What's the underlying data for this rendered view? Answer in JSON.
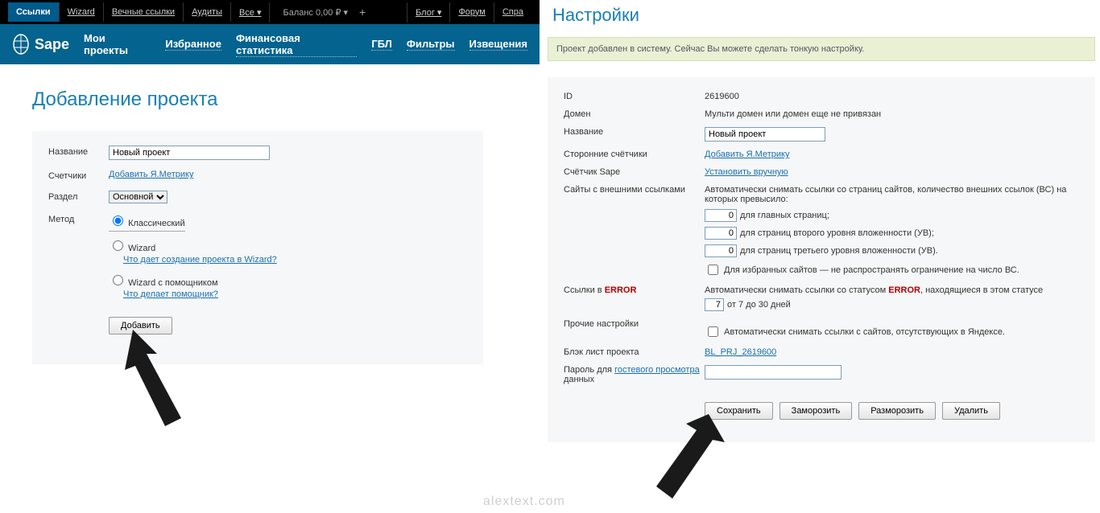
{
  "topbar": {
    "tabs": [
      "Ссылки",
      "Wizard",
      "Вечные ссылки",
      "Аудиты",
      "Все ▾"
    ],
    "balance": "Баланс 0,00 ₽ ▾",
    "plus": "+",
    "right": [
      "Блог ▾",
      "Форум",
      "Спра"
    ]
  },
  "navbar": {
    "brand": "Sape",
    "items": [
      "Мои проекты",
      "Избранное",
      "Финансовая статистика",
      "ГБЛ",
      "Фильтры",
      "Извещения"
    ]
  },
  "left": {
    "title": "Добавление проекта",
    "labels": {
      "name": "Название",
      "counters": "Счетчики",
      "section": "Раздел",
      "method": "Метод"
    },
    "name_value": "Новый проект",
    "counters_link": "Добавить Я.Метрику",
    "section_value": "Основной",
    "radio1": "Классический",
    "radio2": "Wizard",
    "radio2_link": "Что дает создание проекта в Wizard?",
    "radio3": "Wizard с помощником",
    "radio3_link": "Что делает помощник?",
    "submit": "Добавить"
  },
  "right": {
    "title": "Настройки",
    "notice": "Проект добавлен в систему. Сейчас Вы можете сделать тонкую настройку.",
    "rows": {
      "id_label": "ID",
      "id_value": "2619600",
      "domain_label": "Домен",
      "domain_value": "Мульти домен или домен еще не привязан",
      "name_label": "Название",
      "name_value": "Новый проект",
      "ext_counters_label": "Сторонние счётчики",
      "ext_counters_link": "Добавить Я.Метрику",
      "sape_counter_label": "Счётчик Sape",
      "sape_counter_link": "Установить вручную",
      "ext_sites_label": "Сайты с внешними ссылками",
      "ext_sites_text": "Автоматически снимать ссылки со страниц сайтов, количество внешних ссылок (ВС) на которых превысило:",
      "ext_main": "для главных страниц;",
      "ext_lvl2": "для страниц второго уровня вложенности (УВ);",
      "ext_lvl3": "для страниц третьего уровня вложенности (УВ).",
      "ext_val": "0",
      "ext_chk": "Для избранных сайтов — не распространять ограничение на число ВС.",
      "error_label": "Ссылки в ",
      "error_word": "ERROR",
      "error_text1": "Автоматически снимать ссылки со статусом ",
      "error_text2": ", находящиеся в этом статусе",
      "error_text3": "от 7 до 30 дней",
      "error_val": "7",
      "other_label": "Прочие настройки",
      "other_chk": "Автоматически снимать ссылки с сайтов, отсутствующих в Яндексе.",
      "blacklist_label": "Блэк лист проекта",
      "blacklist_link": "BL_PRJ_2619600",
      "guest_label1": "Пароль для ",
      "guest_link": "гостевого просмотра",
      "guest_label2": " данных"
    },
    "buttons": [
      "Сохранить",
      "Заморозить",
      "Разморозить",
      "Удалить"
    ]
  },
  "watermark": "alextext.com"
}
